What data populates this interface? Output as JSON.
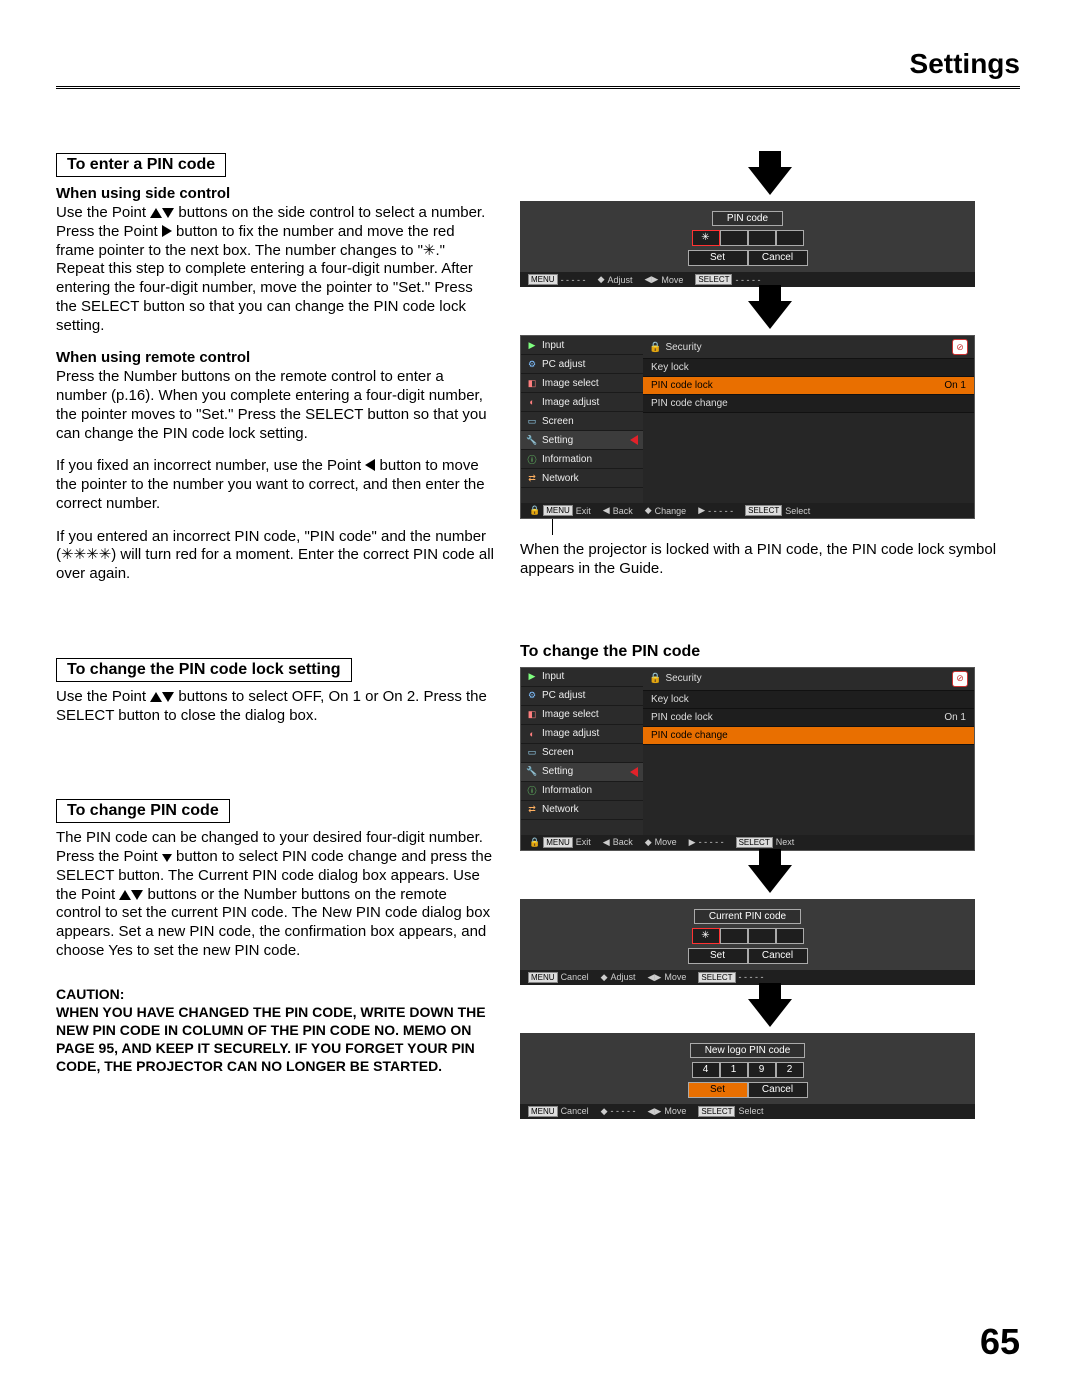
{
  "page_title": "Settings",
  "page_number": "65",
  "left": {
    "h1": "To enter a PIN code",
    "sub1": "When using side control",
    "p1a": "Use the Point ",
    "p1b": " buttons on the side control to select a number. Press the Point ",
    "p1c": " button to fix the number and move the red frame pointer to the next box. The number changes to \"✳.\" Repeat this step to complete entering a four-digit number. After entering the four-digit number, move the pointer to \"Set.\" Press the SELECT button so that you can change the PIN code lock setting.",
    "sub2": "When using remote control",
    "p2": "Press the Number buttons on the remote control to enter a number (p.16). When you complete entering a four-digit number, the pointer moves to \"Set.\" Press the SELECT button so that you can change the PIN code lock setting.",
    "p3a": "If you fixed an incorrect number, use the Point ",
    "p3b": " button to move the pointer to the number you want to correct, and then enter the correct number.",
    "p4": "If you entered an incorrect PIN code, \"PIN code\" and the number (✳✳✳✳) will turn red for a moment. Enter the correct PIN code all over again.",
    "h2": "To change the PIN code lock setting",
    "p5a": "Use the Point ",
    "p5b": " buttons to select OFF, On 1 or On 2. Press the SELECT button to close the dialog box.",
    "h3": "To change PIN code",
    "p6a": "The PIN code can be changed to your desired four-digit number. Press the Point ",
    "p6b": " button to select PIN code change and press the SELECT button. The Current PIN code dialog box appears. Use the Point ",
    "p6c": " buttons or the Number buttons on the remote control to set the current PIN code. The New PIN code dialog box appears. Set a new PIN code, the confirmation box appears, and choose Yes to set the new PIN code.",
    "caution_label": "CAUTION:",
    "caution_text": "WHEN YOU HAVE CHANGED THE PIN CODE, WRITE DOWN THE NEW PIN CODE IN COLUMN OF THE PIN CODE NO. MEMO ON PAGE 95, AND KEEP IT SECURELY. IF YOU FORGET YOUR PIN CODE, THE PROJECTOR CAN NO LONGER BE STARTED."
  },
  "right": {
    "pin_dialog1": {
      "title": "PIN code",
      "star": "✳",
      "set": "Set",
      "cancel": "Cancel"
    },
    "guide1": {
      "menu": "MENU",
      "menu_val": "- - - - -",
      "adjust": "Adjust",
      "move": "Move",
      "select": "SELECT",
      "select_val": "- - - - -"
    },
    "menu_left": [
      "Input",
      "PC adjust",
      "Image select",
      "Image adjust",
      "Screen",
      "Setting",
      "Information",
      "Network"
    ],
    "security_label": "Security",
    "sec_rows1": [
      {
        "label": "Key lock",
        "value": ""
      },
      {
        "label": "PIN code lock",
        "value": "On 1"
      },
      {
        "label": "PIN code change",
        "value": ""
      }
    ],
    "guide2": {
      "menu": "MENU",
      "exit": "Exit",
      "back": "Back",
      "change": "Change",
      "dash": "- - - - -",
      "select": "SELECT",
      "sel": "Select"
    },
    "caption": "When the projector is locked with a PIN code, the PIN code lock symbol appears in the Guide.",
    "h_right": "To change the PIN code",
    "sec_rows2": [
      {
        "label": "Key lock",
        "value": ""
      },
      {
        "label": "PIN code lock",
        "value": "On 1"
      },
      {
        "label": "PIN code change",
        "value": ""
      }
    ],
    "guide3": {
      "menu": "MENU",
      "exit": "Exit",
      "back": "Back",
      "move": "Move",
      "dash": "- - - - -",
      "select": "SELECT",
      "next": "Next"
    },
    "pin_dialog2": {
      "title": "Current PIN code",
      "star": "✳",
      "set": "Set",
      "cancel": "Cancel"
    },
    "guide4": {
      "menu": "MENU",
      "cancel": "Cancel",
      "adjust": "Adjust",
      "move": "Move",
      "select": "SELECT",
      "select_val": "- - - - -"
    },
    "pin_dialog3": {
      "title": "New logo PIN code",
      "d1": "4",
      "d2": "1",
      "d3": "9",
      "d4": "2",
      "set": "Set",
      "cancel": "Cancel"
    },
    "guide5": {
      "menu": "MENU",
      "cancel": "Cancel",
      "dash1": "- - - - -",
      "move": "Move",
      "select": "SELECT",
      "sel": "Select"
    }
  }
}
